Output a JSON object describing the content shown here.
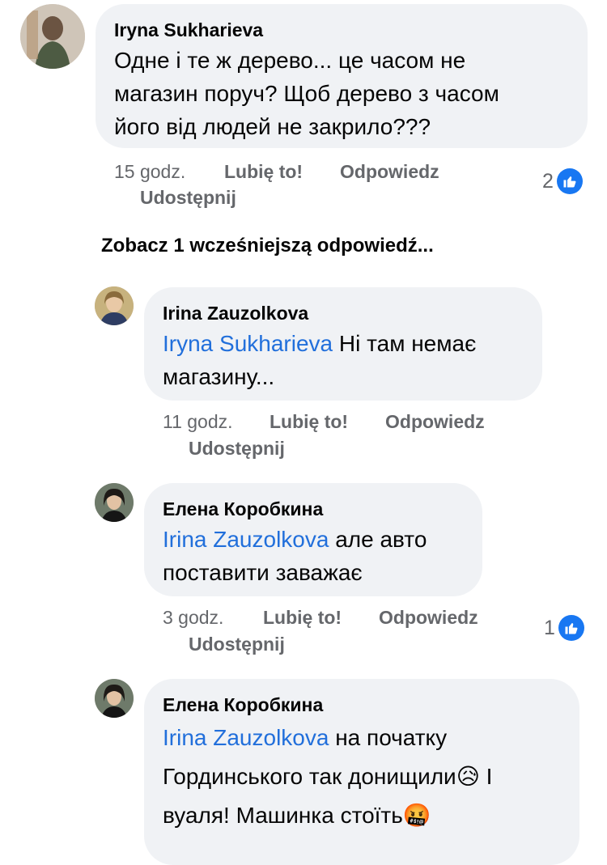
{
  "comments": [
    {
      "author": "Iryna Sukharieva",
      "text": "Одне і те ж дерево... це часом не магазин поруч? Щоб дерево з часом його від людей не закрило???",
      "line1": "Одне і те ж дерево... це часом не",
      "line2": "магазин поруч? Щоб дерево з часом",
      "line3": "його від людей не закрило???",
      "time": "15 godz.",
      "like": "Lubię to!",
      "reply": "Odpowiedz",
      "share": "Udostępnij",
      "likes_count": "2"
    },
    {
      "author": "Irina Zauzolkova",
      "mention": "Iryna Sukharieva",
      "line1_rest": " Ні там немає",
      "line2": "магазину...",
      "time": "11 godz.",
      "like": "Lubię to!",
      "reply": "Odpowiedz",
      "share": "Udostępnij"
    },
    {
      "author": "Елена Коробкина",
      "mention": "Irina Zauzolkova",
      "line1_rest": " але авто",
      "line2": "поставити заважає",
      "time": "3 godz.",
      "like": "Lubię to!",
      "reply": "Odpowiedz",
      "share": "Udostępnij",
      "likes_count": "1"
    },
    {
      "author": "Елена Коробкина",
      "mention": "Irina Zauzolkova",
      "line1_rest": " на початку",
      "line2": "Гординського так донищили",
      "line2_emoji": "😥",
      "line2_rest": " І",
      "line3": "вуаля! Машинка стоїть",
      "line3_emoji": "🤬"
    }
  ],
  "see_more": "Zobacz 1 wcześniejszą odpowiedź...",
  "colors": {
    "mention": "#216fdb",
    "like_badge": "#1877f2",
    "bubble": "#f0f2f5",
    "meta": "#65676b"
  }
}
